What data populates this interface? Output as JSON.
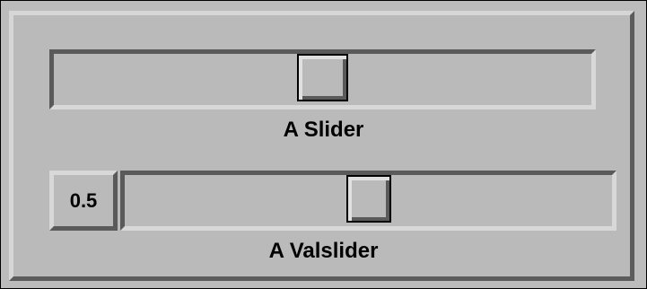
{
  "slider": {
    "label": "A Slider",
    "value": 0.5
  },
  "valslider": {
    "label": "A Valslider",
    "value": 0.5,
    "value_text": "0.5"
  },
  "colors": {
    "background": "#bababa",
    "highlight": "#d8d8d8",
    "shadow": "#5a5a5a",
    "text": "#000000"
  }
}
